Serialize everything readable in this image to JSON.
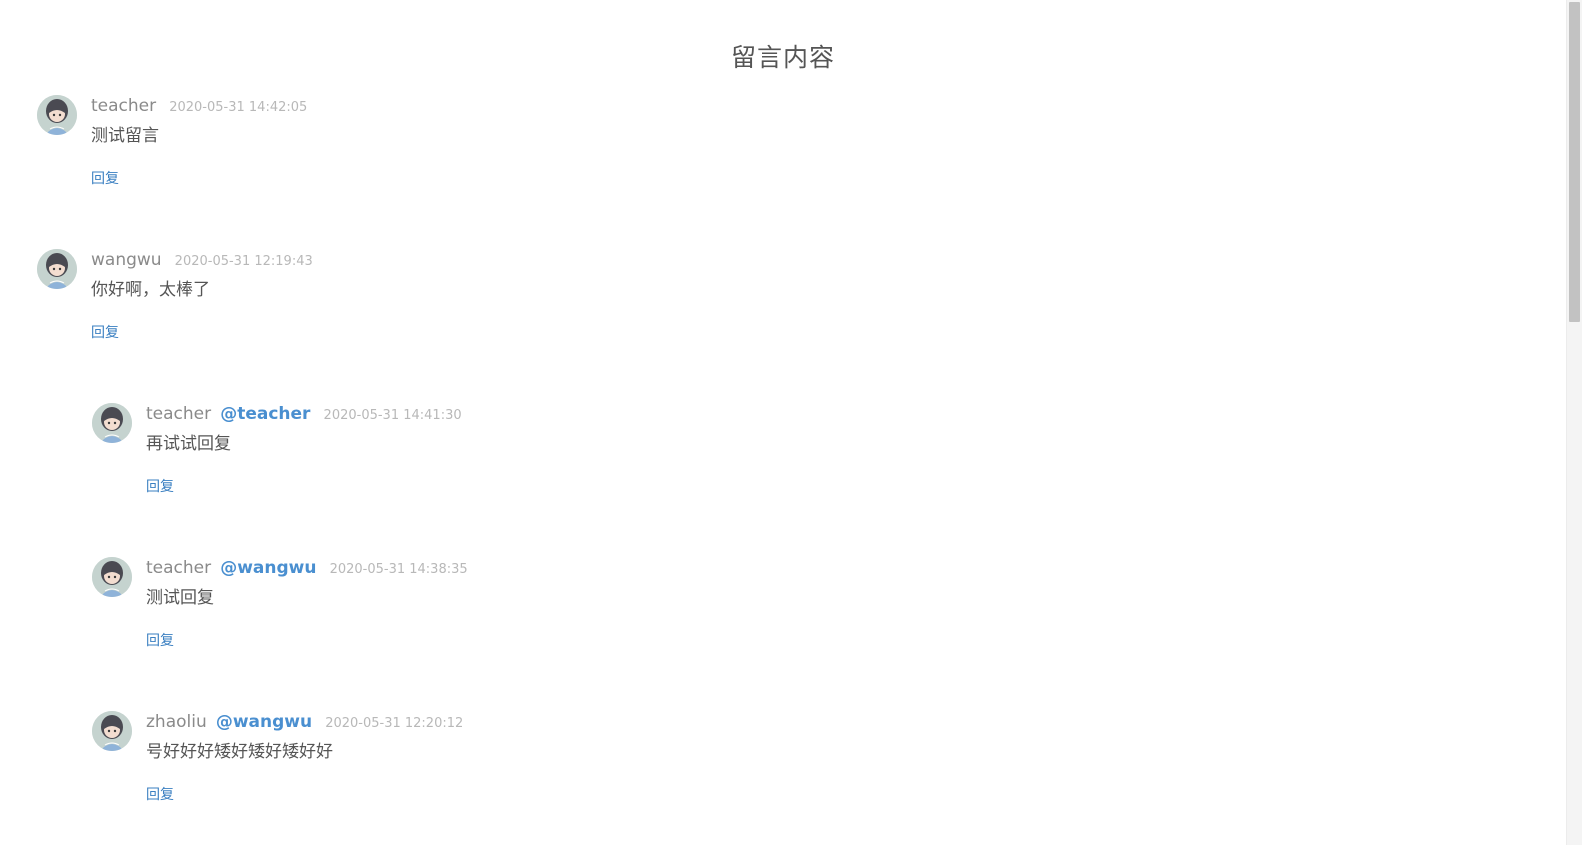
{
  "page": {
    "title": "留言内容"
  },
  "comments": [
    {
      "author": "teacher",
      "mention": "",
      "time": "2020-05-31 14:42:05",
      "text": "测试留言",
      "reply_label": "回复"
    },
    {
      "author": "wangwu",
      "mention": "",
      "time": "2020-05-31 12:19:43",
      "text": "你好啊，太棒了",
      "reply_label": "回复"
    },
    {
      "author": "teacher",
      "mention": "@teacher",
      "time": "2020-05-31 14:41:30",
      "text": "再试试回复",
      "reply_label": "回复"
    },
    {
      "author": "teacher",
      "mention": "@wangwu",
      "time": "2020-05-31 14:38:35",
      "text": "测试回复",
      "reply_label": "回复"
    },
    {
      "author": "zhaoliu",
      "mention": "@wangwu",
      "time": "2020-05-31 12:20:12",
      "text": "号好好好矮好矮好矮好好",
      "reply_label": "回复"
    }
  ],
  "colors": {
    "link": "#3a7fc1",
    "mention": "#4a8fd0",
    "author": "#8a8a8a",
    "time": "#b8b8b8",
    "text": "#555555"
  },
  "icons": {
    "avatar": "anime-girl-avatar-icon"
  }
}
